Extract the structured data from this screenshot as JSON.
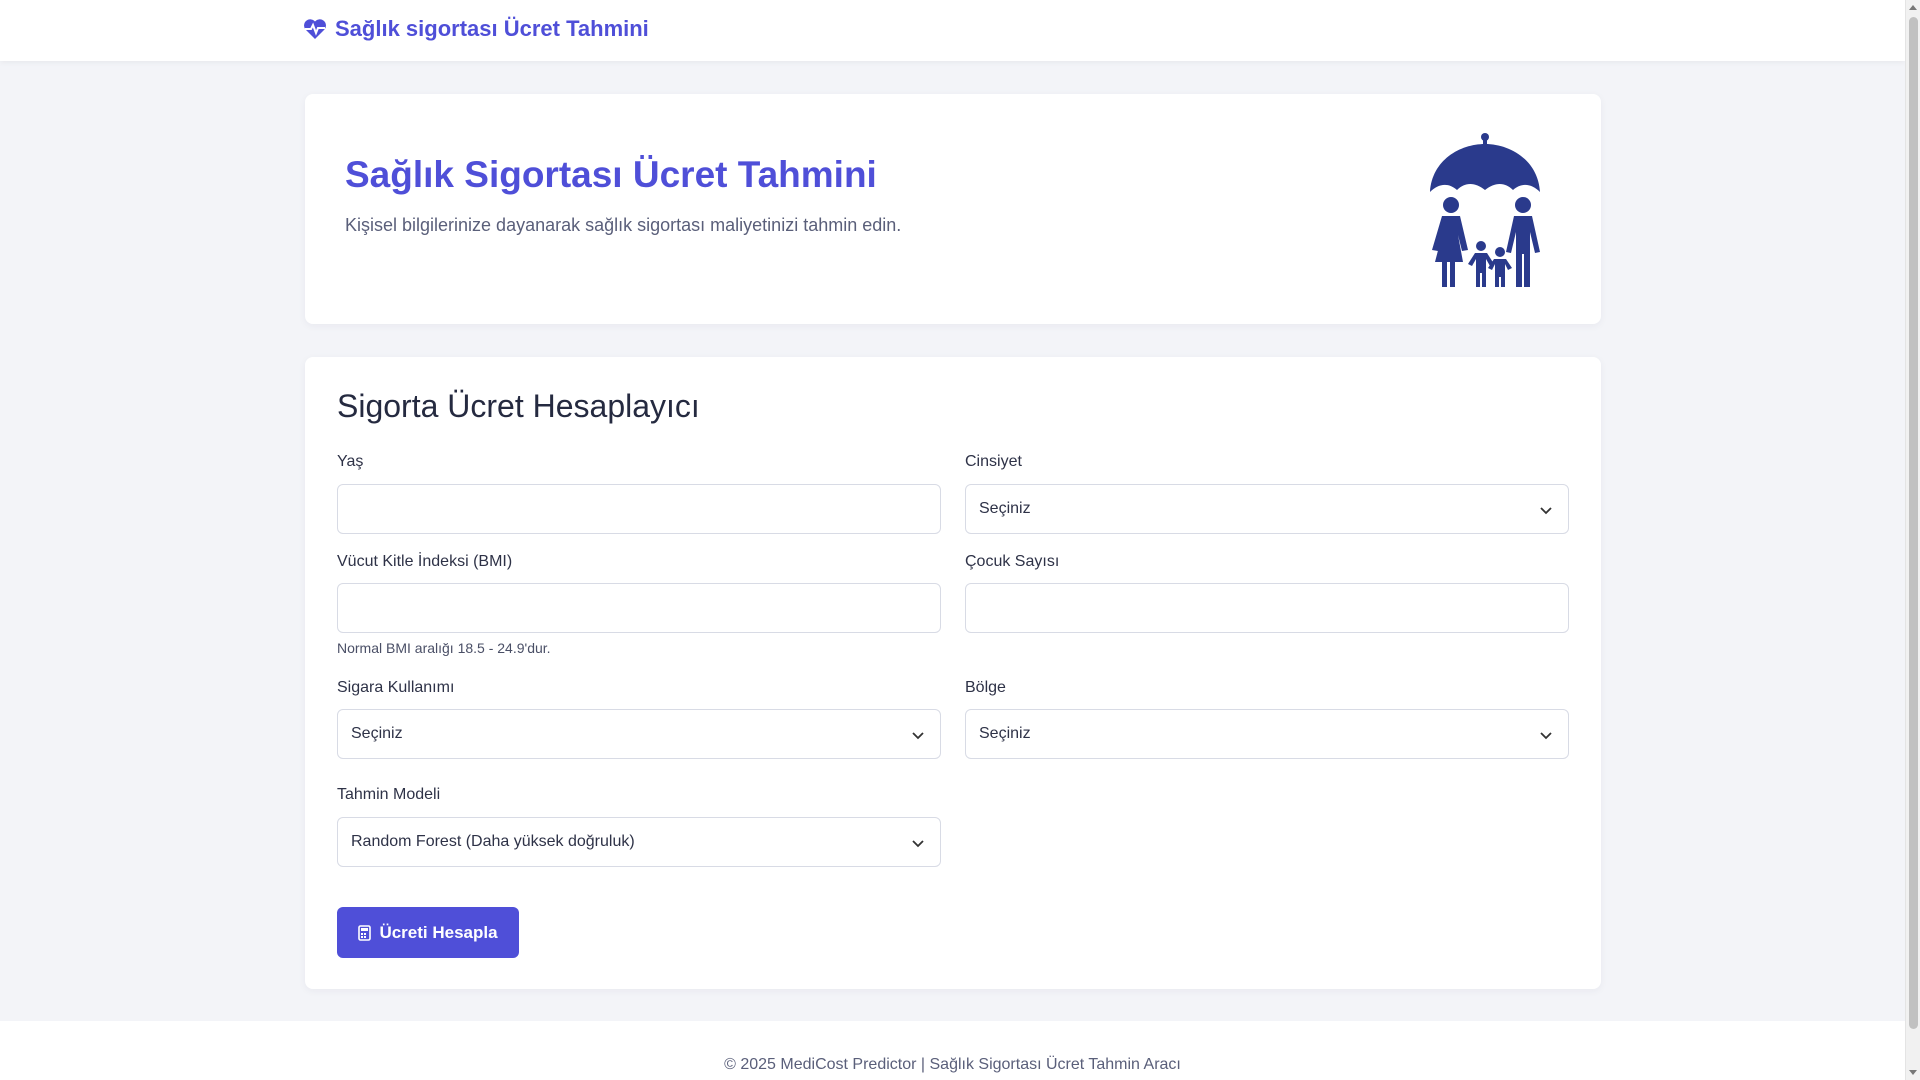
{
  "navbar": {
    "brand": "Sağlık sigortası Ücret Tahmini",
    "brand_icon": "heart-pulse-icon"
  },
  "hero": {
    "title": "Sağlık Sigortası Ücret Tahmini",
    "subtitle": "Kişisel bilgilerinize dayanarak sağlık sigortası maliyetinizi tahmin edin.",
    "image_icon": "family-umbrella-icon"
  },
  "form": {
    "title": "Sigorta Ücret Hesaplayıcı",
    "age": {
      "label": "Yaş",
      "value": ""
    },
    "gender": {
      "label": "Cinsiyet",
      "selected": "Seçiniz"
    },
    "bmi": {
      "label": "Vücut Kitle İndeksi (BMI)",
      "value": "",
      "help": "Normal BMI aralığı 18.5 - 24.9'dur."
    },
    "children": {
      "label": "Çocuk Sayısı",
      "value": ""
    },
    "smoker": {
      "label": "Sigara Kullanımı",
      "selected": "Seçiniz"
    },
    "region": {
      "label": "Bölge",
      "selected": "Seçiniz"
    },
    "model": {
      "label": "Tahmin Modeli",
      "selected": "Random Forest (Daha yüksek doğruluk)"
    },
    "submit_label": "Ücreti Hesapla",
    "submit_icon": "calculator-icon"
  },
  "footer": {
    "text": "© 2025 MediCost Predictor | Sağlık Sigortası Ücret Tahmin Aracı"
  },
  "colors": {
    "accent": "#4f4fd8",
    "icon_navy": "#2a3a8c",
    "background": "#f3f4f8"
  }
}
